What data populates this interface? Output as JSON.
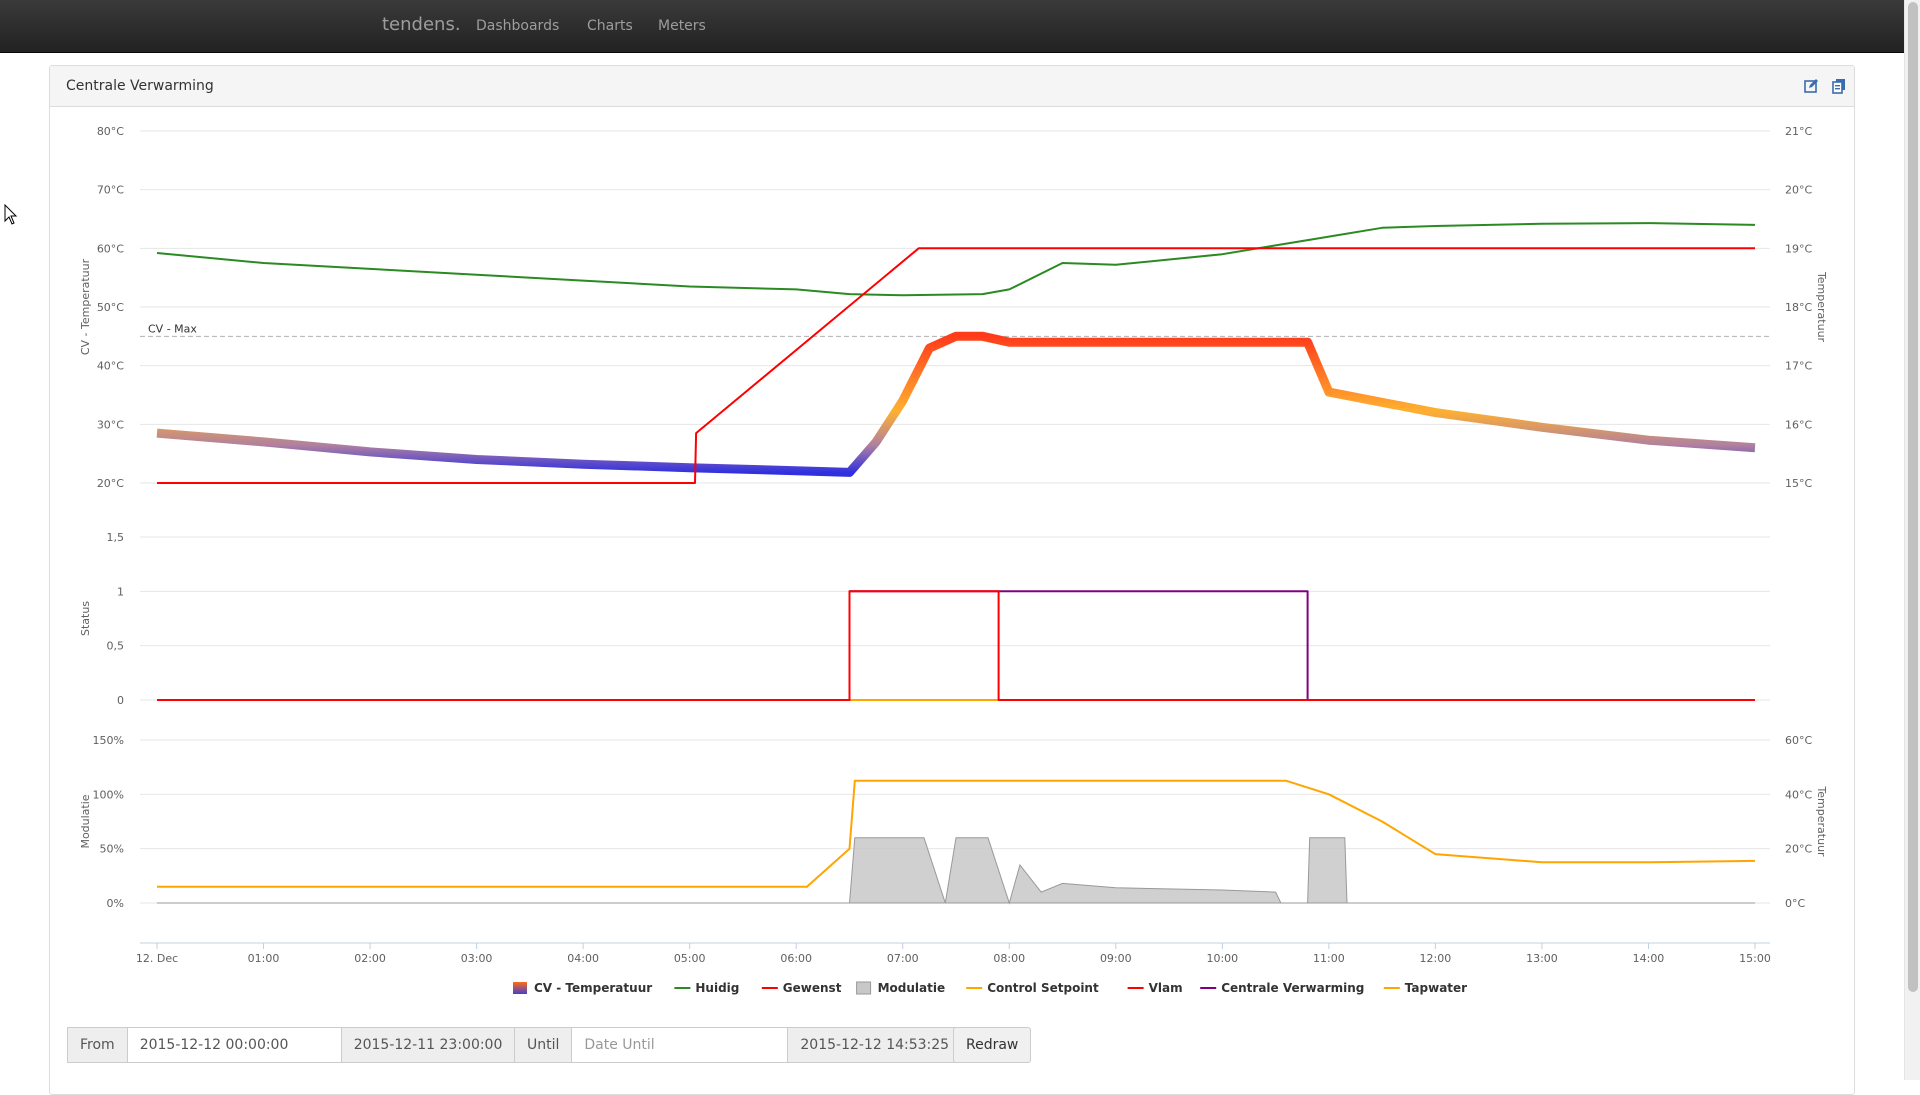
{
  "navbar": {
    "brand": "tendens.",
    "links": [
      "Dashboards",
      "Charts",
      "Meters"
    ]
  },
  "panel": {
    "title": "Centrale Verwarming",
    "icons": [
      "edit-icon",
      "copy-icon"
    ]
  },
  "chart_data": {
    "type": "line",
    "x_ticks": [
      "12. Dec",
      "01:00",
      "02:00",
      "03:00",
      "04:00",
      "05:00",
      "06:00",
      "07:00",
      "08:00",
      "09:00",
      "10:00",
      "11:00",
      "12:00",
      "13:00",
      "14:00",
      "15:00"
    ],
    "x_range_hours": [
      0,
      15
    ],
    "panes": [
      {
        "name": "temperature",
        "left_axis": {
          "label": "CV - Temperatuur",
          "ticks": [
            "20°C",
            "30°C",
            "40°C",
            "50°C",
            "60°C",
            "70°C",
            "80°C"
          ],
          "range": [
            20,
            80
          ]
        },
        "right_axis": {
          "label": "Temperatuur",
          "ticks": [
            "15°C",
            "16°C",
            "17°C",
            "18°C",
            "19°C",
            "20°C",
            "21°C"
          ],
          "range": [
            15,
            21
          ]
        },
        "plot_line": {
          "label": "CV - Max",
          "value": 45
        }
      },
      {
        "name": "status",
        "left_axis": {
          "label": "Status",
          "ticks": [
            "0",
            "0,5",
            "1",
            "1,5"
          ],
          "range": [
            0,
            1.5
          ]
        }
      },
      {
        "name": "modulation",
        "left_axis": {
          "label": "Modulatie",
          "ticks": [
            "0%",
            "50%",
            "100%",
            "150%"
          ],
          "range": [
            0,
            150
          ]
        },
        "right_axis": {
          "label": "Temperatuur",
          "ticks": [
            "0°C",
            "20°C",
            "40°C",
            "60°C"
          ],
          "range": [
            0,
            60
          ]
        }
      }
    ],
    "series": [
      {
        "name": "CV - Temperatuur",
        "color": "#ff6a1a",
        "pane": "temperature",
        "axis": "left",
        "points": [
          [
            0,
            28.5
          ],
          [
            1,
            27
          ],
          [
            2,
            25.3
          ],
          [
            3,
            24
          ],
          [
            4,
            23.2
          ],
          [
            5,
            22.6
          ],
          [
            6,
            22.1
          ],
          [
            6.5,
            21.8
          ],
          [
            6.75,
            27
          ],
          [
            7,
            34
          ],
          [
            7.25,
            43
          ],
          [
            7.5,
            45
          ],
          [
            7.75,
            45
          ],
          [
            8,
            44
          ],
          [
            8.5,
            44
          ],
          [
            9,
            44
          ],
          [
            10,
            44
          ],
          [
            10.5,
            44
          ],
          [
            10.8,
            44
          ],
          [
            11,
            35.5
          ],
          [
            12,
            32
          ],
          [
            13,
            29.5
          ],
          [
            14,
            27.3
          ],
          [
            15,
            26
          ]
        ]
      },
      {
        "name": "Huidig",
        "color": "#2b8a22",
        "pane": "temperature",
        "axis": "right",
        "points": [
          [
            0,
            18.92
          ],
          [
            1,
            18.75
          ],
          [
            2,
            18.65
          ],
          [
            3,
            18.55
          ],
          [
            4,
            18.45
          ],
          [
            5,
            18.35
          ],
          [
            6,
            18.3
          ],
          [
            6.5,
            18.22
          ],
          [
            7,
            18.2
          ],
          [
            7.75,
            18.22
          ],
          [
            8,
            18.3
          ],
          [
            8.5,
            18.75
          ],
          [
            9,
            18.72
          ],
          [
            10,
            18.9
          ],
          [
            10.5,
            19.05
          ],
          [
            11,
            19.2
          ],
          [
            11.5,
            19.35
          ],
          [
            12,
            19.38
          ],
          [
            13,
            19.42
          ],
          [
            14,
            19.43
          ],
          [
            15,
            19.4
          ]
        ]
      },
      {
        "name": "Gewenst",
        "color": "#ff0000",
        "pane": "temperature",
        "axis": "right",
        "points": [
          [
            0,
            15
          ],
          [
            5.05,
            15
          ],
          [
            5.06,
            15.85
          ],
          [
            7.15,
            19
          ],
          [
            15,
            19
          ]
        ]
      },
      {
        "name": "Modulatie",
        "color": "#c8c8c8",
        "pane": "modulation",
        "axis": "left",
        "points": [
          [
            0,
            0
          ],
          [
            6.5,
            0
          ],
          [
            6.55,
            60
          ],
          [
            7,
            60
          ],
          [
            7.2,
            60
          ],
          [
            7.4,
            0
          ],
          [
            7.5,
            60
          ],
          [
            7.8,
            60
          ],
          [
            8,
            0
          ],
          [
            8.1,
            35
          ],
          [
            8.3,
            10
          ],
          [
            8.5,
            18
          ],
          [
            9,
            14
          ],
          [
            10,
            12
          ],
          [
            10.5,
            10
          ],
          [
            10.55,
            0
          ],
          [
            10.8,
            0
          ],
          [
            10.82,
            60
          ],
          [
            11.15,
            60
          ],
          [
            11.17,
            0
          ],
          [
            15,
            0
          ]
        ]
      },
      {
        "name": "Control Setpoint",
        "color": "#ffa500",
        "pane": "modulation",
        "axis": "right",
        "points": [
          [
            0,
            6
          ],
          [
            6.1,
            6
          ],
          [
            6.5,
            20
          ],
          [
            6.55,
            45
          ],
          [
            7.1,
            45
          ],
          [
            7.2,
            45
          ],
          [
            10.6,
            45
          ],
          [
            11,
            40
          ],
          [
            11.5,
            30
          ],
          [
            12,
            18
          ],
          [
            13,
            15
          ],
          [
            14,
            15
          ],
          [
            15,
            15.5
          ]
        ]
      },
      {
        "name": "Vlam",
        "color": "#ff0000",
        "pane": "status",
        "axis": "left",
        "points": [
          [
            0,
            0
          ],
          [
            6.5,
            0
          ],
          [
            6.5,
            1
          ],
          [
            7.9,
            1
          ],
          [
            7.9,
            0
          ],
          [
            15,
            0
          ]
        ]
      },
      {
        "name": "Centrale Verwarming",
        "color": "#800080",
        "pane": "status",
        "axis": "left",
        "points": [
          [
            0,
            0
          ],
          [
            6.5,
            0
          ],
          [
            6.5,
            1
          ],
          [
            10.8,
            1
          ],
          [
            10.8,
            0
          ],
          [
            15,
            0
          ]
        ]
      },
      {
        "name": "Tapwater",
        "color": "#ffa500",
        "pane": "status",
        "axis": "left",
        "points": [
          [
            0,
            0
          ],
          [
            15,
            0
          ]
        ]
      }
    ],
    "legend": {
      "placement": "bottom-center"
    }
  },
  "controls": {
    "from_label": "From",
    "from_value": "2015-12-12 00:00:00",
    "from_hint": "2015-12-11 23:00:00",
    "until_label": "Until",
    "until_placeholder": "Date Until",
    "until_hint": "2015-12-12 14:53:25",
    "redraw_label": "Redraw"
  }
}
